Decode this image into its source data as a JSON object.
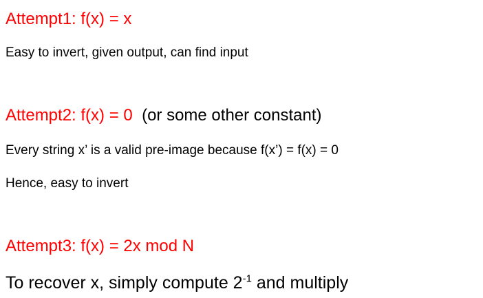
{
  "attempt1": {
    "heading": "Attempt1: f(x) = x",
    "description": "Easy to invert, given output, can find input"
  },
  "attempt2": {
    "heading": "Attempt2: f(x) = 0",
    "heading_note": "(or some other constant)",
    "line1": "Every string x’ is a valid pre-image because f(x’) = f(x) = 0",
    "line2": "Hence, easy to invert"
  },
  "attempt3": {
    "heading": "Attempt3: f(x) = 2x mod N",
    "line_before": "To recover x, simply compute 2",
    "exponent": "-1",
    "line_after": " and multiply"
  },
  "colors": {
    "heading": "#ff0000",
    "text": "#000000"
  }
}
